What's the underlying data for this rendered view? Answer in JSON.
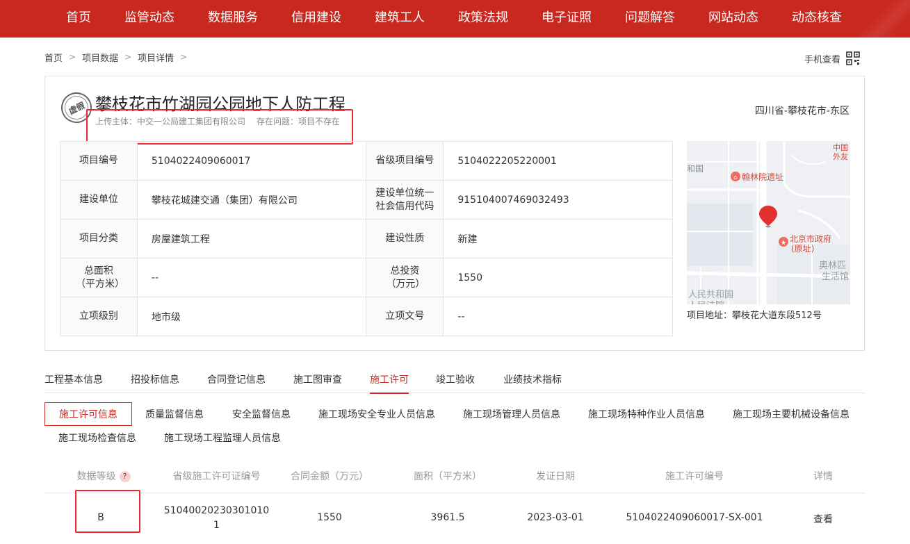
{
  "nav": {
    "items": [
      "首页",
      "监管动态",
      "数据服务",
      "信用建设",
      "建筑工人",
      "政策法规",
      "电子证照",
      "问题解答",
      "网站动态",
      "动态核查"
    ]
  },
  "breadcrumb": [
    "首页",
    "项目数据",
    "项目详情"
  ],
  "mobile_view": "手机查看",
  "project": {
    "stamp": "虚假",
    "title": "攀枝花市竹湖园公园地下人防工程",
    "uploader": "上传主体：中交一公局建工集团有限公司",
    "issue": "存在问题：项目不存在",
    "region": "四川省-攀枝花市-东区",
    "info": [
      {
        "l1": "项目编号",
        "v1": "5104022409060017",
        "l2": "省级项目编号",
        "v2": "5104022205220001"
      },
      {
        "l1": "建设单位",
        "v1": "攀枝花城建交通（集团）有限公司",
        "l2": "建设单位统一社会信用代码",
        "v2": "915104007469032493"
      },
      {
        "l1": "项目分类",
        "v1": "房屋建筑工程",
        "l2": "建设性质",
        "v2": "新建"
      },
      {
        "l1": "总面积（平方米）",
        "v1": "--",
        "l2": "总投资（万元）",
        "v2": "1550"
      },
      {
        "l1": "立项级别",
        "v1": "地市级",
        "l2": "立项文号",
        "v2": "--"
      }
    ],
    "address": "项目地址：攀枝花大道东段512号"
  },
  "map": {
    "labels": {
      "poi1": "翰林院遗址",
      "poi2": "北京市政府",
      "poi2_sub": "(原址)",
      "corner_top1": "中国",
      "corner_top2": "外友",
      "left_top": "和国",
      "right1": "奥林匹",
      "right2": "生活馆",
      "bottom1": "人民共和国",
      "bottom2": "人民法院"
    }
  },
  "tabs": [
    "工程基本信息",
    "招投标信息",
    "合同登记信息",
    "施工图审查",
    "施工许可",
    "竣工验收",
    "业绩技术指标"
  ],
  "active_tab": "施工许可",
  "subtabs": [
    "施工许可信息",
    "质量监督信息",
    "安全监督信息",
    "施工现场安全专业人员信息",
    "施工现场管理人员信息",
    "施工现场特种作业人员信息",
    "施工现场主要机械设备信息",
    "施工现场检查信息",
    "施工现场工程监理人员信息"
  ],
  "table": {
    "headers": [
      "数据等级",
      "省级施工许可证编号",
      "合同金额（万元）",
      "面积（平方米）",
      "发证日期",
      "施工许可编号",
      "详情"
    ],
    "help_mark": "?",
    "rows": [
      {
        "grade": "B",
        "permit_line1": "51040020230301010",
        "permit_line2": "1",
        "amount": "1550",
        "area": "3961.5",
        "date": "2023-03-01",
        "permit_no": "5104022409060017-SX-001",
        "detail": "查看"
      }
    ]
  },
  "colors": {
    "brand": "#c8281e",
    "highlight_box": "#e8272e"
  }
}
